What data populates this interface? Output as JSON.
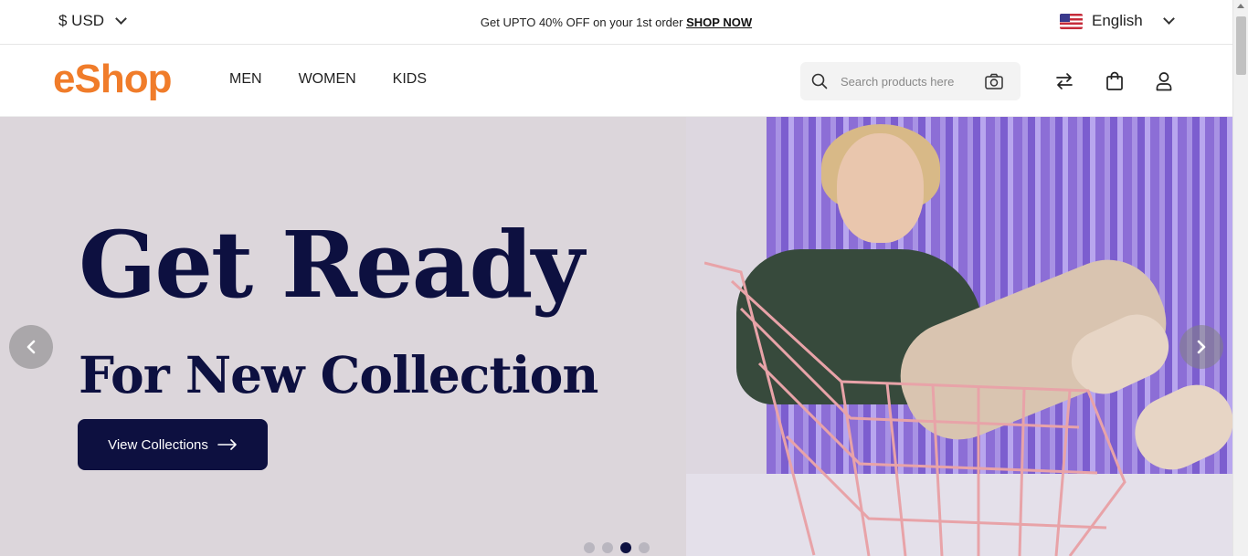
{
  "topbar": {
    "currency": "$ USD",
    "promo_text": "Get UPTO 40% OFF on your 1st order",
    "promo_link": "SHOP NOW",
    "language": "English"
  },
  "navbar": {
    "logo": "eShop",
    "links": [
      "MEN",
      "WOMEN",
      "KIDS"
    ],
    "search_placeholder": "Search products here"
  },
  "hero": {
    "title": "Get Ready",
    "subtitle": "For New Collection",
    "cta_label": "View Collections",
    "slides_total": 4,
    "active_slide": 3
  },
  "colors": {
    "brand": "#f07c2a",
    "navy": "#0d1040",
    "hero_bg": "#dcd6db",
    "curtain": "#8c6ed6"
  },
  "icons": [
    "chevron-down-icon",
    "us-flag-icon",
    "search-icon",
    "camera-icon",
    "compare-icon",
    "bag-icon",
    "user-icon",
    "arrow-right-icon",
    "chevron-left-icon",
    "chevron-right-icon"
  ]
}
